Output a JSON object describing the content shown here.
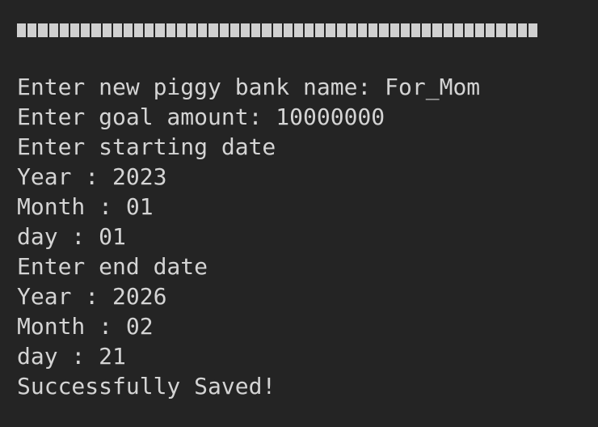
{
  "terminal": {
    "block_count": 49,
    "lines": [
      "Enter new piggy bank name: For_Mom",
      "Enter goal amount: 10000000",
      "Enter starting date",
      "Year : 2023",
      "Month : 01",
      "day : 01",
      "Enter end date",
      "Year : 2026",
      "Month : 02",
      "day : 21",
      "Successfully Saved!"
    ]
  },
  "colors": {
    "background": "#242424",
    "text": "#d4d4d4",
    "block": "#d0d0d0"
  }
}
